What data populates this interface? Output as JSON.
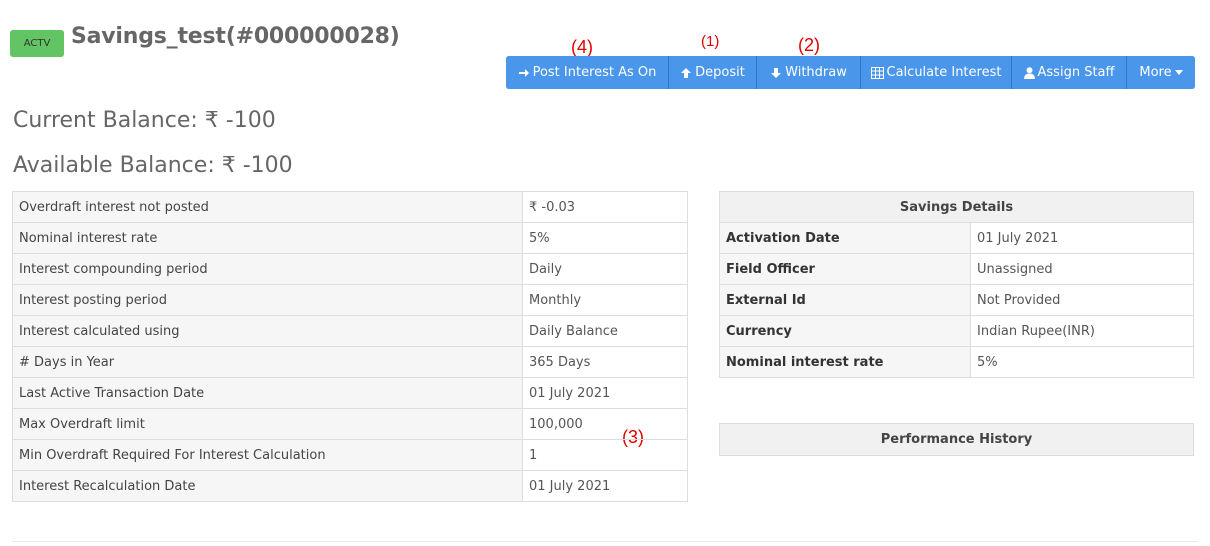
{
  "header": {
    "status_badge": "ACTV",
    "title": "Savings_test(#000000028)"
  },
  "annotations": [
    "(4)",
    "(1)",
    "(2)",
    "(3)"
  ],
  "toolbar": {
    "post_interest": "Post Interest As On",
    "deposit": "Deposit",
    "withdraw": "Withdraw",
    "calculate_interest": "Calculate Interest",
    "assign_staff": "Assign Staff",
    "more": "More"
  },
  "balances": {
    "current": "Current Balance: ₹ -100",
    "available": "Available Balance: ₹ -100"
  },
  "account_table": [
    {
      "label": "Overdraft interest not posted",
      "value": "₹ -0.03"
    },
    {
      "label": "Nominal interest rate",
      "value": "5%"
    },
    {
      "label": "Interest compounding period",
      "value": "Daily"
    },
    {
      "label": "Interest posting period",
      "value": "Monthly"
    },
    {
      "label": "Interest calculated using",
      "value": "Daily Balance"
    },
    {
      "label": "# Days in Year",
      "value": "365 Days"
    },
    {
      "label": "Last Active Transaction Date",
      "value": "01 July 2021"
    },
    {
      "label": "Max Overdraft limit",
      "value": "100,000"
    },
    {
      "label": "Min Overdraft Required For Interest Calculation",
      "value": "1"
    },
    {
      "label": "Interest Recalculation Date",
      "value": "01 July 2021"
    }
  ],
  "savings_details": {
    "heading": "Savings Details",
    "rows": [
      {
        "label": "Activation Date",
        "value": "01 July 2021"
      },
      {
        "label": "Field Officer",
        "value": "Unassigned"
      },
      {
        "label": "External Id",
        "value": "Not Provided"
      },
      {
        "label": "Currency",
        "value": "Indian Rupee(INR)"
      },
      {
        "label": "Nominal interest rate",
        "value": "5%"
      }
    ]
  },
  "performance_history": {
    "heading": "Performance History"
  },
  "colors": {
    "badge": "#62c462",
    "toolbar": "#3d8ee8",
    "annotation": "#e00000"
  },
  "icons": [
    "arrow-right-icon",
    "arrow-up-icon",
    "arrow-down-icon",
    "calculator-icon",
    "user-icon",
    "caret-down-icon"
  ]
}
